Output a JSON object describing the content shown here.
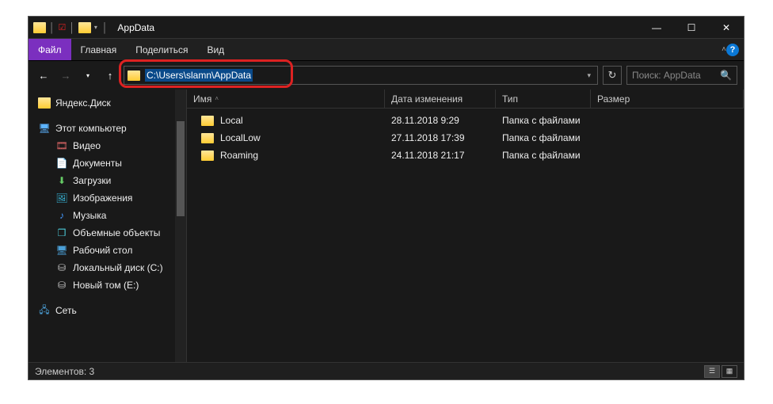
{
  "window": {
    "title": "AppData"
  },
  "ribbon": {
    "file": "Файл",
    "home": "Главная",
    "share": "Поделиться",
    "view": "Вид"
  },
  "address": {
    "path": "C:\\Users\\slamn\\AppData"
  },
  "search": {
    "placeholder": "Поиск: AppData"
  },
  "tree": {
    "items": [
      {
        "label": "Яндекс.Диск",
        "icon": "folder",
        "level": 1
      },
      {
        "label": "",
        "sep": true
      },
      {
        "label": "Этот компьютер",
        "icon": "monitor",
        "level": 1
      },
      {
        "label": "Видео",
        "icon": "video",
        "level": 2
      },
      {
        "label": "Документы",
        "icon": "doc",
        "level": 2
      },
      {
        "label": "Загрузки",
        "icon": "dl",
        "level": 2
      },
      {
        "label": "Изображения",
        "icon": "pic",
        "level": 2
      },
      {
        "label": "Музыка",
        "icon": "music",
        "level": 2
      },
      {
        "label": "Объемные объекты",
        "icon": "3d",
        "level": 2
      },
      {
        "label": "Рабочий стол",
        "icon": "desk",
        "level": 2
      },
      {
        "label": "Локальный диск (C:)",
        "icon": "drive",
        "level": 2
      },
      {
        "label": "Новый том (E:)",
        "icon": "drive",
        "level": 2
      },
      {
        "label": "",
        "sep": true
      },
      {
        "label": "Сеть",
        "icon": "net",
        "level": 1
      }
    ]
  },
  "columns": {
    "name": "Имя",
    "date": "Дата изменения",
    "type": "Тип",
    "size": "Размер"
  },
  "rows": [
    {
      "name": "Local",
      "date": "28.11.2018 9:29",
      "type": "Папка с файлами",
      "size": ""
    },
    {
      "name": "LocalLow",
      "date": "27.11.2018 17:39",
      "type": "Папка с файлами",
      "size": ""
    },
    {
      "name": "Roaming",
      "date": "24.11.2018 21:17",
      "type": "Папка с файлами",
      "size": ""
    }
  ],
  "status": {
    "count_label": "Элементов: 3"
  }
}
